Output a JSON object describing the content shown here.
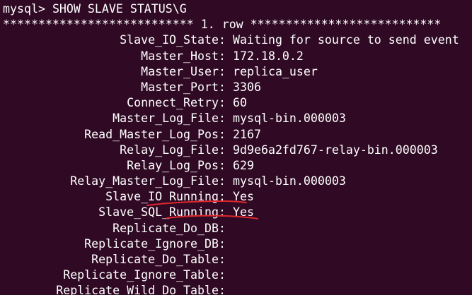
{
  "terminal": {
    "prompt": "mysql> ",
    "command": "SHOW SLAVE STATUS\\G",
    "row_header": "*************************** 1. row ***************************",
    "fields": [
      {
        "name": "Slave_IO_State",
        "value": "Waiting for source to send event"
      },
      {
        "name": "Master_Host",
        "value": "172.18.0.2"
      },
      {
        "name": "Master_User",
        "value": "replica_user"
      },
      {
        "name": "Master_Port",
        "value": "3306"
      },
      {
        "name": "Connect_Retry",
        "value": "60"
      },
      {
        "name": "Master_Log_File",
        "value": "mysql-bin.000003"
      },
      {
        "name": "Read_Master_Log_Pos",
        "value": "2167"
      },
      {
        "name": "Relay_Log_File",
        "value": "9d9e6a2fd767-relay-bin.000003"
      },
      {
        "name": "Relay_Log_Pos",
        "value": "629"
      },
      {
        "name": "Relay_Master_Log_File",
        "value": "mysql-bin.000003"
      },
      {
        "name": "Slave_IO_Running",
        "value": "Yes"
      },
      {
        "name": "Slave_SQL_Running",
        "value": "Yes"
      },
      {
        "name": "Replicate_Do_DB",
        "value": ""
      },
      {
        "name": "Replicate_Ignore_DB",
        "value": ""
      },
      {
        "name": "Replicate_Do_Table",
        "value": ""
      },
      {
        "name": "Replicate_Ignore_Table",
        "value": ""
      },
      {
        "name": "Replicate_Wild_Do_Table",
        "value": ""
      }
    ]
  },
  "colors": {
    "background": "#300a24",
    "text": "#ffffff",
    "annotation": "#e0262c"
  }
}
